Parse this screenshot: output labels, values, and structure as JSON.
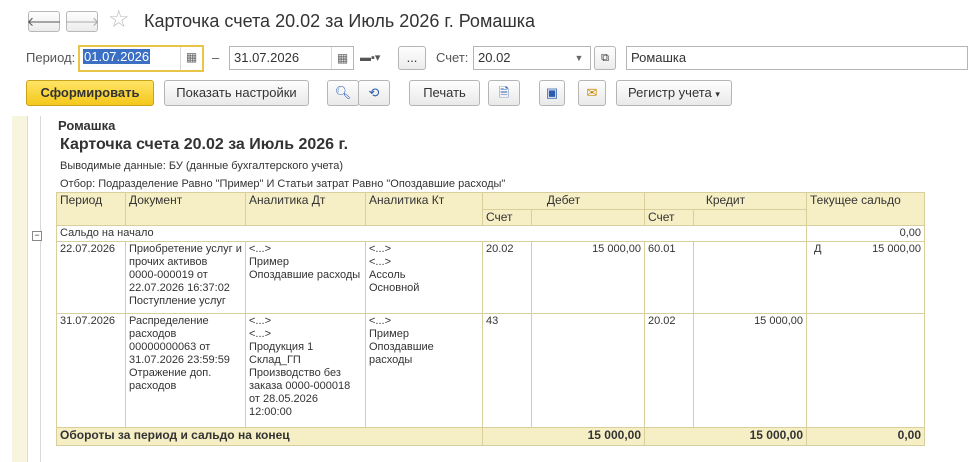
{
  "window": {
    "title": "Карточка счета 20.02 за Июль 2026 г. Ромашка"
  },
  "filters": {
    "period_label": "Период:",
    "date_from": "01.07.2026",
    "date_sep": "–",
    "date_to": "31.07.2026",
    "ellipsis": "...",
    "account_label": "Счет:",
    "account": "20.02",
    "organization": "Ромашка"
  },
  "toolbar": {
    "generate": "Сформировать",
    "settings": "Показать настройки",
    "print": "Печать",
    "register": "Регистр учета"
  },
  "report": {
    "org": "Ромашка",
    "title": "Карточка счета 20.02 за Июль 2026 г.",
    "output_line": "Выводимые данные: БУ (данные бухгалтерского учета)",
    "filter_line": "Отбор: Подразделение Равно \"Пример\" И Статьи затрат Равно \"Опоздавшие расходы\"",
    "headers": {
      "period": "Период",
      "document": "Документ",
      "analytics_dt": "Аналитика Дт",
      "analytics_kt": "Аналитика Кт",
      "debit": "Дебет",
      "credit": "Кредит",
      "balance": "Текущее сальдо",
      "account": "Счет"
    },
    "opening": {
      "label": "Сальдо на начало",
      "value": "0,00"
    },
    "rows": [
      {
        "period": "22.07.2026",
        "document": [
          "Приобретение услуг и",
          "прочих активов",
          "0000-000019 от",
          "22.07.2026 16:37:02",
          "Поступление услуг"
        ],
        "analytics_dt": [
          "<...>",
          "Пример",
          "Опоздавшие расходы"
        ],
        "analytics_kt": [
          "<...>",
          "<...>",
          "Ассоль",
          "Основной"
        ],
        "dt_account": "20.02",
        "dt_sum": "15 000,00",
        "kt_account": "60.01",
        "kt_sum": "",
        "bal_type": "Д",
        "bal_sum": "15 000,00"
      },
      {
        "period": "31.07.2026",
        "document": [
          "Распределение",
          "расходов",
          "00000000063 от",
          "31.07.2026 23:59:59",
          "Отражение доп.",
          "расходов"
        ],
        "analytics_dt": [
          "<...>",
          "<...>",
          "Продукция 1",
          "Склад_ГП",
          "Производство без",
          "заказа 0000-000018",
          "от 28.05.2026",
          "12:00:00"
        ],
        "analytics_kt": [
          "<...>",
          "Пример",
          "Опоздавшие расходы"
        ],
        "dt_account": "43",
        "dt_sum": "",
        "kt_account": "20.02",
        "kt_sum": "15 000,00",
        "bal_type": "",
        "bal_sum": ""
      }
    ],
    "totals": {
      "label": "Обороты за период и сальдо на конец",
      "debit": "15 000,00",
      "credit": "15 000,00",
      "balance": "0,00"
    }
  }
}
